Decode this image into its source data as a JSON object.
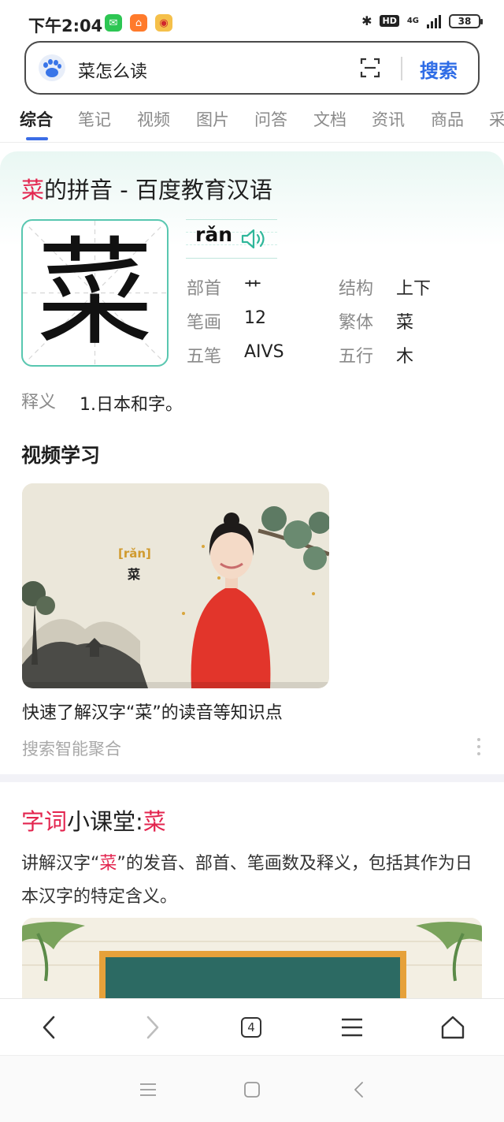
{
  "status_bar": {
    "time": "下午2:04",
    "network": "4G",
    "battery": "38"
  },
  "search": {
    "query": "菜怎么读",
    "button": "搜索"
  },
  "tabs": [
    "综合",
    "笔记",
    "视频",
    "图片",
    "问答",
    "文档",
    "资讯",
    "商品",
    "采"
  ],
  "active_tab_index": 0,
  "card1": {
    "title_char": "菜",
    "title_rest": "的拼音 - 百度教育汉语",
    "character": "菜",
    "pinyin": "rǎn",
    "attributes": [
      {
        "label": "部首",
        "value": "艹"
      },
      {
        "label": "结构",
        "value": "上下"
      },
      {
        "label": "笔画",
        "value": "12"
      },
      {
        "label": "繁体",
        "value": "菜"
      },
      {
        "label": "五笔",
        "value": "AIVS"
      },
      {
        "label": "五行",
        "value": "木"
      }
    ],
    "meaning_label": "释义",
    "meaning": "1.日本和字。",
    "video_section_title": "视频学习",
    "video_overlay_pinyin": "[rǎn]",
    "video_overlay_char": "菜",
    "video_caption": "快速了解汉字“菜”的读音等知识点",
    "source": "搜索智能聚合"
  },
  "card2": {
    "title_red": "字词",
    "title_mid": "小课堂:",
    "title_char": "菜",
    "desc_pre": "讲解汉字“",
    "desc_char": "菜",
    "desc_post": "”的发音、部首、笔画数及释义，包括其作为日本汉字的特定含义。"
  },
  "browser_bar": {
    "tab_count": "4"
  },
  "colors": {
    "accent": "#2e6ce6",
    "highlight": "#e3254f",
    "teal": "#58c7b0"
  }
}
